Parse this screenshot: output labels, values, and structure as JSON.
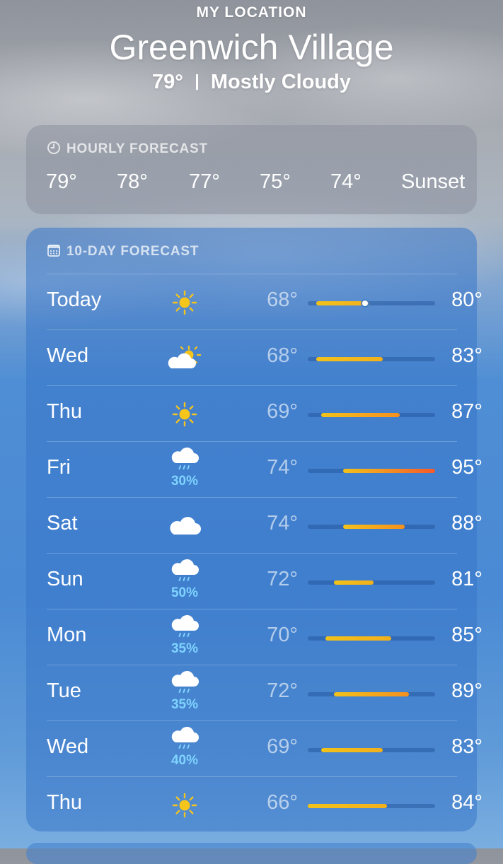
{
  "header": {
    "location_label": "MY LOCATION",
    "city": "Greenwich Village",
    "current_temp": "79°",
    "condition": "Mostly Cloudy"
  },
  "hourly": {
    "title": "HOURLY FORECAST",
    "icon": "clock-icon",
    "items": [
      "79°",
      "78°",
      "77°",
      "75°",
      "74°",
      "Sunset"
    ]
  },
  "daily": {
    "title": "10-DAY FORECAST",
    "icon": "calendar-icon",
    "range_min": 66,
    "range_max": 95,
    "current_temp_value": 79,
    "days": [
      {
        "day": "Today",
        "icon": "sun",
        "precip": "",
        "low": "68°",
        "high": "80°",
        "low_v": 68,
        "high_v": 80
      },
      {
        "day": "Wed",
        "icon": "partly-cloudy",
        "precip": "",
        "low": "68°",
        "high": "83°",
        "low_v": 68,
        "high_v": 83
      },
      {
        "day": "Thu",
        "icon": "sun",
        "precip": "",
        "low": "69°",
        "high": "87°",
        "low_v": 69,
        "high_v": 87
      },
      {
        "day": "Fri",
        "icon": "rain",
        "precip": "30%",
        "low": "74°",
        "high": "95°",
        "low_v": 74,
        "high_v": 95
      },
      {
        "day": "Sat",
        "icon": "cloud",
        "precip": "",
        "low": "74°",
        "high": "88°",
        "low_v": 74,
        "high_v": 88
      },
      {
        "day": "Sun",
        "icon": "rain",
        "precip": "50%",
        "low": "72°",
        "high": "81°",
        "low_v": 72,
        "high_v": 81
      },
      {
        "day": "Mon",
        "icon": "rain",
        "precip": "35%",
        "low": "70°",
        "high": "85°",
        "low_v": 70,
        "high_v": 85
      },
      {
        "day": "Tue",
        "icon": "rain",
        "precip": "35%",
        "low": "72°",
        "high": "89°",
        "low_v": 72,
        "high_v": 89
      },
      {
        "day": "Wed",
        "icon": "rain",
        "precip": "40%",
        "low": "69°",
        "high": "83°",
        "low_v": 69,
        "high_v": 83
      },
      {
        "day": "Thu",
        "icon": "sun",
        "precip": "",
        "low": "66°",
        "high": "84°",
        "low_v": 66,
        "high_v": 84
      }
    ]
  },
  "colors": {
    "sun": "#f6c51c",
    "precip": "#7fd3ff",
    "bar_cool": "#f2c21a",
    "bar_warm": "#f5901e",
    "bar_hot": "#f55a2c"
  }
}
